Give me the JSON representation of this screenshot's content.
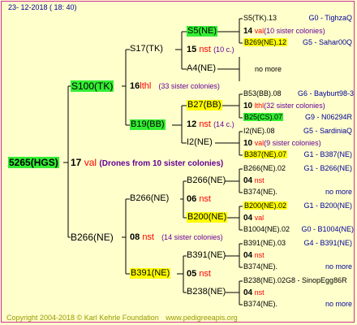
{
  "header": {
    "date": "23- 12-2018 ( 18: 40)"
  },
  "footer": {
    "copyright": "Copyright 2004-2018 © Karl Kehrle Foundation",
    "site": "www.pedigreeapis.org"
  },
  "root": {
    "id": "5265(HGS)",
    "num": "17",
    "val": "val",
    "note": "(Drones from 10 sister colonies)"
  },
  "gen1": {
    "top": {
      "id": "S100(TK)",
      "num": "16",
      "lthl": "lthl",
      "note": "(33 sister colonies)"
    },
    "bottom": {
      "id": "B266(NE)",
      "num": "08",
      "nst": "nst",
      "note": "(14 sister colonies)"
    }
  },
  "gen2": {
    "s17": {
      "id": "S17(TK)",
      "num": "15",
      "nst": "nst",
      "note": "(10 c.)"
    },
    "b19": {
      "id": "B19(BB)",
      "num": "12",
      "nst": "nst",
      "note": "(14 c.)"
    },
    "b266": {
      "id": "B266(NE)",
      "num": "06",
      "nst": "nst"
    },
    "b391": {
      "id": "B391(NE)",
      "num": "05",
      "nst": "nst"
    }
  },
  "gen3": {
    "s5": "S5(NE)",
    "a4": "A4(NE)",
    "b27": {
      "id": "B27(BB)",
      "num": "10",
      "lthl": "lthl"
    },
    "i2": {
      "id": "I2(NE)",
      "num": "10",
      "val": "val"
    },
    "b266a": {
      "id": "B266(NE)",
      "num": "04",
      "nst": "nst"
    },
    "b200": {
      "id": "B200(NE)",
      "num": "04",
      "val": "val"
    },
    "b391": {
      "id": "B391(NE)",
      "num": "04",
      "nst": "nst"
    },
    "b238": {
      "id": "B238(NE)",
      "num": "04",
      "nst": "nst"
    }
  },
  "gen4": {
    "r1": {
      "id": "S5(TK).13",
      "label": "G0 - TighzaQ"
    },
    "r2": {
      "num": "14",
      "val": "val",
      "note": "(10 sister colonies)"
    },
    "r3": {
      "id": "B269(NE).12",
      "label": "G5 - Sahar00Q"
    },
    "r4": {
      "text": "no more"
    },
    "r5": {
      "id": "B53(BB).08",
      "label": "G6 - Bayburt98-3"
    },
    "r6": {
      "num": "10",
      "lthl": "lthl",
      "note": "(32 sister colonies)"
    },
    "r7": {
      "id": "B25(CS).07",
      "label": "G9 - N06294R"
    },
    "r8": {
      "id": "I2(NE).08",
      "label": "G5 - SardiniaQ"
    },
    "r9": {
      "num": "10",
      "val": "val",
      "note": "(9 sister colonies)"
    },
    "r10": {
      "id": "B387(NE).07",
      "label": "G1 - B387(NE)"
    },
    "r11": {
      "id": "B266(NE).02",
      "label": "G1 - B266(NE)"
    },
    "r12": {
      "num": "04",
      "nst": "nst"
    },
    "r13": {
      "id": "B374(NE).",
      "label": "no more"
    },
    "r14": {
      "id": "B200(NE).02",
      "label": "G1 - B200(NE)"
    },
    "r15": {
      "num": "04",
      "val": "val"
    },
    "r16": {
      "id": "B1004(NE).02",
      "label": "G0 - B1004(NE)"
    },
    "r17": {
      "id": "B391(NE).03",
      "label": "G4 - B391(NE)"
    },
    "r18": {
      "num": "04",
      "nst": "nst"
    },
    "r19": {
      "id": "B374(NE).",
      "label": "no more"
    },
    "r20": {
      "id": "B238(NE).02G8 - SinopEgg86R"
    },
    "r21": {
      "num": "04",
      "nst": "nst"
    },
    "r22": {
      "id": "B374(NE).",
      "label": "no more"
    }
  }
}
